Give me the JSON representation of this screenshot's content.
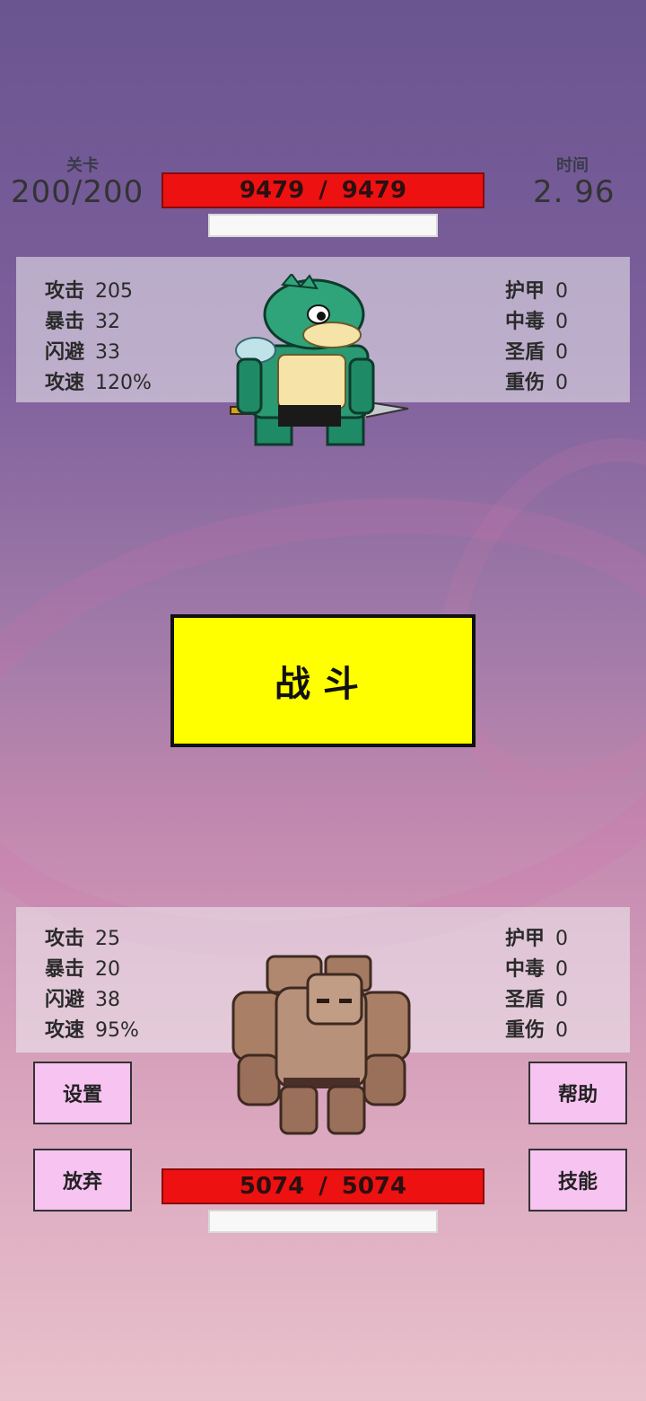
{
  "header": {
    "level_label": "关卡",
    "level_value": "200/200",
    "time_label": "时间",
    "time_value": "2. 96"
  },
  "enemy": {
    "hp_current": "9479",
    "hp_sep": "/",
    "hp_max": "9479",
    "stats_left": [
      {
        "label": "攻击",
        "value": "205"
      },
      {
        "label": "暴击",
        "value": "32"
      },
      {
        "label": "闪避",
        "value": "33"
      },
      {
        "label": "攻速",
        "value": "120%"
      }
    ],
    "stats_right": [
      {
        "label": "护甲",
        "value": "0"
      },
      {
        "label": "中毒",
        "value": "0"
      },
      {
        "label": "圣盾",
        "value": "0"
      },
      {
        "label": "重伤",
        "value": "0"
      }
    ]
  },
  "fight_button": "战斗",
  "player": {
    "hp_current": "5074",
    "hp_sep": "/",
    "hp_max": "5074",
    "stats_left": [
      {
        "label": "攻击",
        "value": "25"
      },
      {
        "label": "暴击",
        "value": "20"
      },
      {
        "label": "闪避",
        "value": "38"
      },
      {
        "label": "攻速",
        "value": "95%"
      }
    ],
    "stats_right": [
      {
        "label": "护甲",
        "value": "0"
      },
      {
        "label": "中毒",
        "value": "0"
      },
      {
        "label": "圣盾",
        "value": "0"
      },
      {
        "label": "重伤",
        "value": "0"
      }
    ]
  },
  "buttons": {
    "settings": "设置",
    "help": "帮助",
    "give_up": "放弃",
    "skills": "技能"
  },
  "colors": {
    "hp_bar": "#ee1111",
    "fight_button": "#ffff00",
    "side_button": "#f7c3f0"
  },
  "sprites": {
    "enemy": "frog-warrior-with-spear",
    "player": "rock-golem"
  }
}
